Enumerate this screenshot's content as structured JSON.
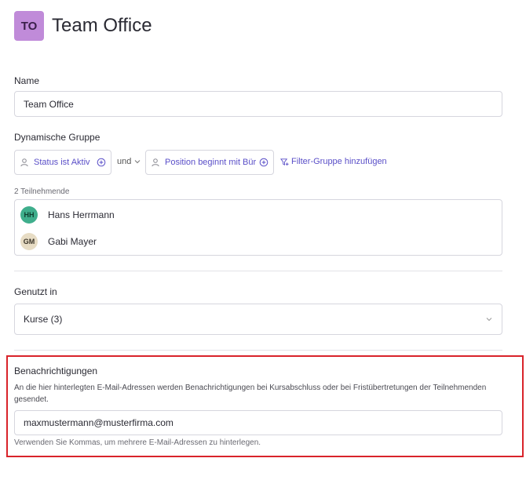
{
  "header": {
    "initials": "TO",
    "title": "Team Office",
    "avatar_color": "#c08bd9"
  },
  "name": {
    "label": "Name",
    "value": "Team Office"
  },
  "dynamic_group": {
    "label": "Dynamische Gruppe",
    "filter1": "Status ist Aktiv",
    "connector": "und",
    "filter2": "Position beginnt mit Bür",
    "add_filter_group": "Filter-Gruppe hinzufügen"
  },
  "participants": {
    "count_label": "2 Teilnehmende",
    "items": [
      {
        "initials": "HH",
        "name": "Hans Herrmann",
        "color": "#3fae8c"
      },
      {
        "initials": "GM",
        "name": "Gabi Mayer",
        "color": "#e7dcc4"
      }
    ]
  },
  "used_in": {
    "label": "Genutzt in",
    "value": "Kurse (3)"
  },
  "notifications": {
    "label": "Benachrichtigungen",
    "description": "An die hier hinterlegten E-Mail-Adressen werden Benachrichtigungen bei Kursabschluss oder bei Fristübertretungen der Teilnehmenden gesendet.",
    "email_value": "maxmustermann@musterfirma.com",
    "hint": "Verwenden Sie Kommas, um mehrere E-Mail-Adressen zu hinterlegen.",
    "highlight_color": "#d9232a"
  },
  "accent_color": "#5a4fc8"
}
